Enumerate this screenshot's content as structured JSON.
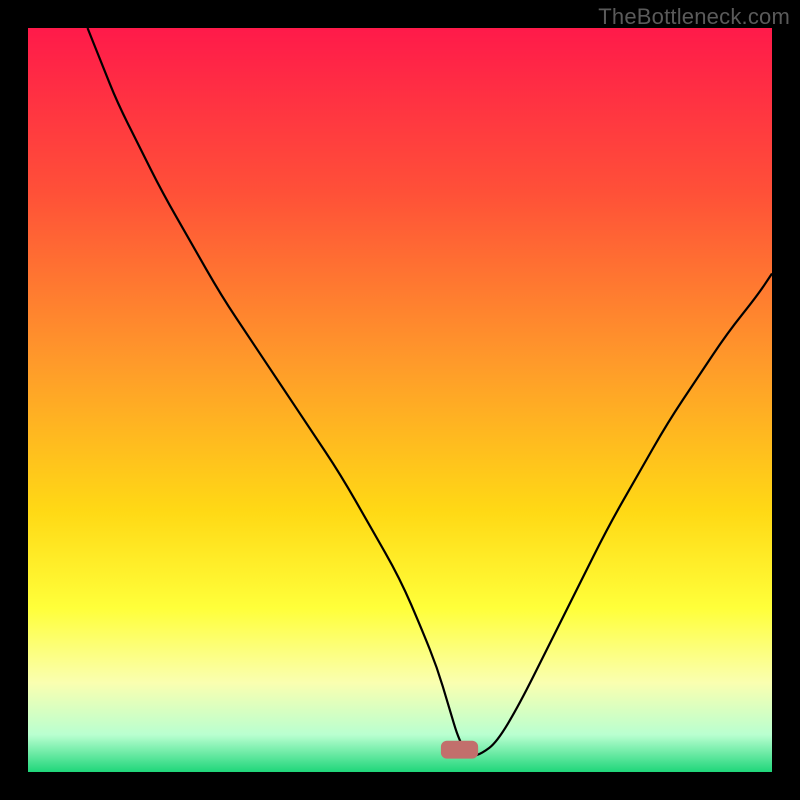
{
  "watermark": "TheBottleneck.com",
  "chart_data": {
    "type": "line",
    "title": "",
    "xlabel": "",
    "ylabel": "",
    "xlim": [
      0,
      100
    ],
    "ylim": [
      0,
      100
    ],
    "grid": false,
    "legend": false,
    "background_gradient_stops": [
      {
        "offset": 0,
        "color": "#ff1a4a"
      },
      {
        "offset": 22,
        "color": "#ff5038"
      },
      {
        "offset": 45,
        "color": "#ff9a2a"
      },
      {
        "offset": 65,
        "color": "#ffd915"
      },
      {
        "offset": 78,
        "color": "#ffff3a"
      },
      {
        "offset": 88,
        "color": "#faffb0"
      },
      {
        "offset": 95,
        "color": "#b9ffd0"
      },
      {
        "offset": 100,
        "color": "#1fd67a"
      }
    ],
    "marker": {
      "cx": 58,
      "cy": 3,
      "w": 5,
      "h": 2.4,
      "fill": "#c26f6c"
    },
    "series": [
      {
        "name": "bottleneck-curve",
        "color": "#000000",
        "x": [
          8,
          10,
          12,
          15,
          18,
          22,
          26,
          30,
          34,
          38,
          42,
          46,
          50,
          53,
          55,
          56.5,
          58,
          59.5,
          61,
          63,
          66,
          70,
          74,
          78,
          82,
          86,
          90,
          94,
          98,
          100
        ],
        "y": [
          100,
          95,
          90,
          84,
          78,
          71,
          64,
          58,
          52,
          46,
          40,
          33,
          26,
          19,
          14,
          9,
          4,
          2,
          2.5,
          4,
          9,
          17,
          25,
          33,
          40,
          47,
          53,
          59,
          64,
          67
        ]
      }
    ]
  }
}
